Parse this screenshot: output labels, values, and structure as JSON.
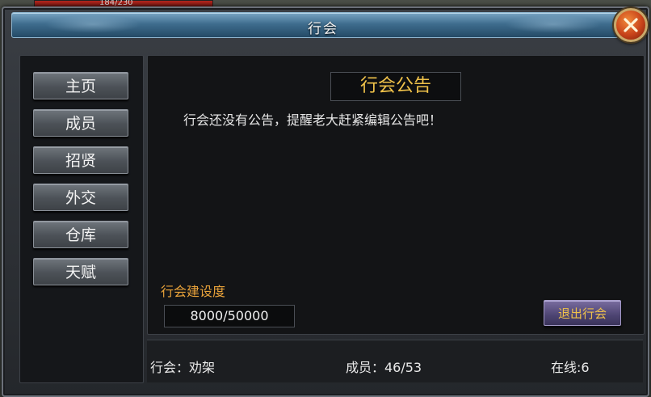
{
  "hud": {
    "hp_text": "184/230"
  },
  "window": {
    "title": "行会"
  },
  "sidebar": {
    "items": [
      {
        "label": "主页"
      },
      {
        "label": "成员"
      },
      {
        "label": "招贤"
      },
      {
        "label": "外交"
      },
      {
        "label": "仓库"
      },
      {
        "label": "天赋"
      }
    ]
  },
  "notice": {
    "title": "行会公告",
    "text": "行会还没有公告，提醒老大赶紧编辑公告吧！"
  },
  "construction": {
    "label": "行会建设度",
    "value": "8000/50000"
  },
  "actions": {
    "leave_label": "退出行会"
  },
  "footer": {
    "guild": "行会：劝架",
    "members": "成员：46/53",
    "online": "在线:6"
  },
  "colors": {
    "accent_gold": "#f0c24a",
    "label_orange": "#e8a23a",
    "close_orange": "#c8431a"
  },
  "icons": {
    "close": "close-icon"
  }
}
